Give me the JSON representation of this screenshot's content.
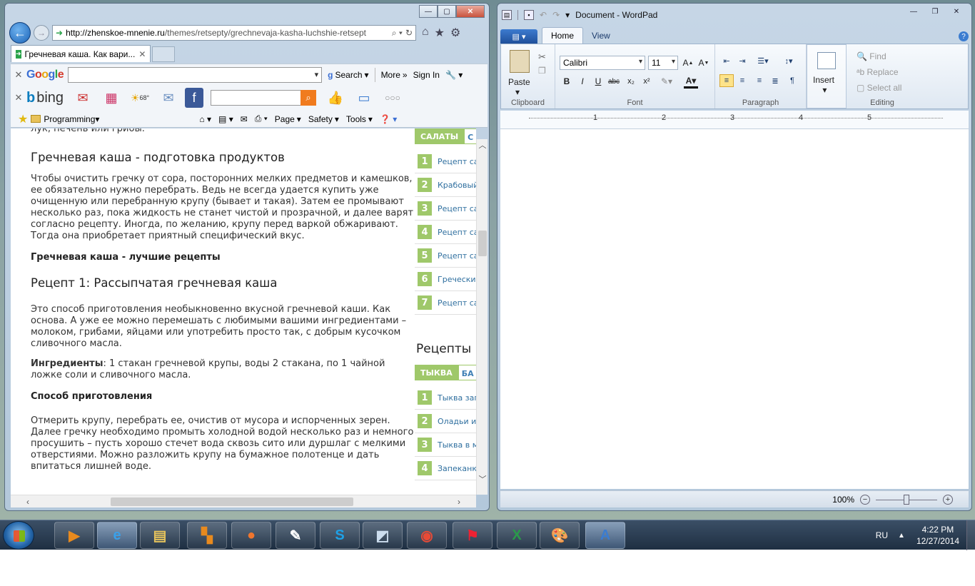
{
  "ie": {
    "address": {
      "host": "http://zhenskoe-mnenie.ru",
      "path": "/themes/retsepty/grechnevaja-kasha-luchshie-retsept"
    },
    "tab_title": "Гречневая каша. Как вари...",
    "google": {
      "logo": "Google",
      "search_label": "Search",
      "more_label": "More",
      "signin_label": "Sign In"
    },
    "bing": {
      "logo": "bing",
      "weather": "68°"
    },
    "favorites": {
      "folder": "Programming",
      "page_label": "Page",
      "safety_label": "Safety",
      "tools_label": "Tools"
    },
    "article": {
      "cut_line": "лук, печень или грибы.",
      "h2_prep": "Гречневая каша - подготовка продуктов",
      "p_prep": "Чтобы очистить гречку от сора, посторонних мелких предметов и камешков, ее обязательно нужно перебрать. Ведь не всегда удается купить уже очищенную или перебранную крупу (бывает и такая). Затем ее промывают несколько раз, пока жидкость не станет чистой и прозрачной, и далее варят согласно рецепту. Иногда, по желанию, крупу перед варкой обжаривают. Тогда она приобретает приятный специфический вкус.",
      "bold_best": "Гречневая каша - лучшие рецепты",
      "h2_recipe1": "Рецепт 1: Рассыпчатая гречневая каша",
      "p_recipe1": " Это способ приготовления необыкновенно вкусной гречневой каши. Как основа. А уже ее можно перемешать с любимыми вашими ингредиентами – молоком, грибами, яйцами или употребить просто так, с добрым кусочком сливочного масла.",
      "ingredients_label": "Ингредиенты",
      "ingredients_text": ": 1 стакан гречневой крупы, воды 2 стакана, по 1 чайной ложке соли и сливочного масла.",
      "bold_method": "Способ приготовления",
      "p_method": "Отмерить крупу, перебрать ее, очистив от мусора и испорченных зерен. Далее гречку необходимо промыть холодной водой несколько раз и немного просушить – пусть хорошо стечет вода сквозь сито или дуршлаг с мелкими отверстиями. Можно разложить крупу на бумажное полотенце и дать впитаться лишней воде."
    },
    "sidebar": {
      "tab1_a": "САЛАТЫ",
      "tab1_b": "С",
      "list1": [
        {
          "num": "1",
          "text": "Рецепт са"
        },
        {
          "num": "2",
          "text": "Крабовый"
        },
        {
          "num": "3",
          "text": "Рецепт са"
        },
        {
          "num": "4",
          "text": "Рецепт са"
        },
        {
          "num": "5",
          "text": "Рецепт са"
        },
        {
          "num": "6",
          "text": "Греческий"
        },
        {
          "num": "7",
          "text": "Рецепт са"
        }
      ],
      "heading": "Рецепты",
      "tab2_a": "ТЫКВА",
      "tab2_b": "БА",
      "list2": [
        {
          "num": "1",
          "text": "Тыква зап"
        },
        {
          "num": "2",
          "text": "Оладьи из"
        },
        {
          "num": "3",
          "text": "Тыква в м"
        },
        {
          "num": "4",
          "text": "Запеканк"
        }
      ]
    }
  },
  "wordpad": {
    "title": "Document - WordPad",
    "tabs": {
      "home": "Home",
      "view": "View"
    },
    "clipboard": {
      "paste": "Paste",
      "label": "Clipboard"
    },
    "font": {
      "name": "Calibri",
      "size": "11",
      "label": "Font"
    },
    "paragraph": {
      "label": "Paragraph"
    },
    "insert": {
      "label": "Insert"
    },
    "editing": {
      "find": "Find",
      "replace": "Replace",
      "select_all": "Select all",
      "label": "Editing"
    },
    "ruler": [
      "1",
      "2",
      "3",
      "4",
      "5"
    ],
    "zoom": "100%",
    "zoom_level": 0.5
  },
  "taskbar": {
    "lang": "RU",
    "time": "4:22 PM",
    "date": "12/27/2014"
  }
}
